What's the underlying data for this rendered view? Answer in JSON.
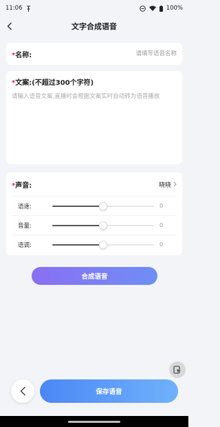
{
  "status_bar": {
    "time": "11:06",
    "battery": "100%"
  },
  "nav": {
    "title": "文字合成语音"
  },
  "name_field": {
    "required_mark": "*",
    "label": "名称:",
    "placeholder": "请填写语音名称"
  },
  "script_field": {
    "required_mark": "*",
    "label": "文案:(不超过300个字符)",
    "placeholder": "请输入语音文案,直播时会根据文案实时自动转为语音播放"
  },
  "voice": {
    "required_mark": "*",
    "label": "声音:",
    "selected": "晓晓",
    "sliders": [
      {
        "label": "语速:",
        "value": "0",
        "level": 0.5
      },
      {
        "label": "音量:",
        "value": "0",
        "level": 0.5
      },
      {
        "label": "语调:",
        "value": "0",
        "level": 0.5
      }
    ]
  },
  "buttons": {
    "synthesize": "合成语音",
    "save": "保存语音"
  },
  "icons": {
    "back": "chevron-left-icon",
    "status": [
      "pin-icon",
      "dnd-icon",
      "wifi-icon",
      "battery-icon"
    ],
    "voice_arrow": "chevron-right-icon",
    "floating": "app-switch-icon"
  },
  "colors": {
    "required": "#e0294a",
    "synth_gradient": [
      "#8a6ff2",
      "#6f8ef5"
    ],
    "save_gradient": [
      "#4c87f5",
      "#6fb2fb"
    ]
  }
}
